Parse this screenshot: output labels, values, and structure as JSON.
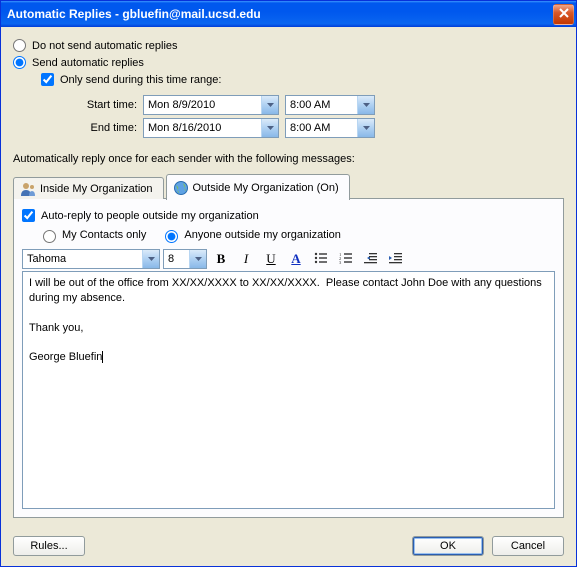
{
  "title": "Automatic Replies - gbluefin@mail.ucsd.edu",
  "radios": {
    "dont_send": "Do not send automatic replies",
    "send": "Send automatic replies"
  },
  "timerange": {
    "only_label": "Only send during this time range:",
    "start_label": "Start time:",
    "end_label": "End time:",
    "start_date": "Mon 8/9/2010",
    "end_date": "Mon 8/16/2010",
    "start_time": "8:00 AM",
    "end_time": "8:00 AM"
  },
  "section_label": "Automatically reply once for each sender with the following messages:",
  "tabs": {
    "inside": "Inside My Organization",
    "outside": "Outside My Organization (On)"
  },
  "outside": {
    "autoreply_label": "Auto-reply to people outside my organization",
    "contacts_only": "My Contacts only",
    "anyone": "Anyone outside my organization"
  },
  "toolbar": {
    "font": "Tahoma",
    "size": "8"
  },
  "message_body": "I will be out of the office from XX/XX/XXXX to XX/XX/XXXX.  Please contact John Doe with any questions during my absence.\n\nThank you,\n\nGeorge Bluefin",
  "buttons": {
    "rules": "Rules...",
    "ok": "OK",
    "cancel": "Cancel"
  }
}
